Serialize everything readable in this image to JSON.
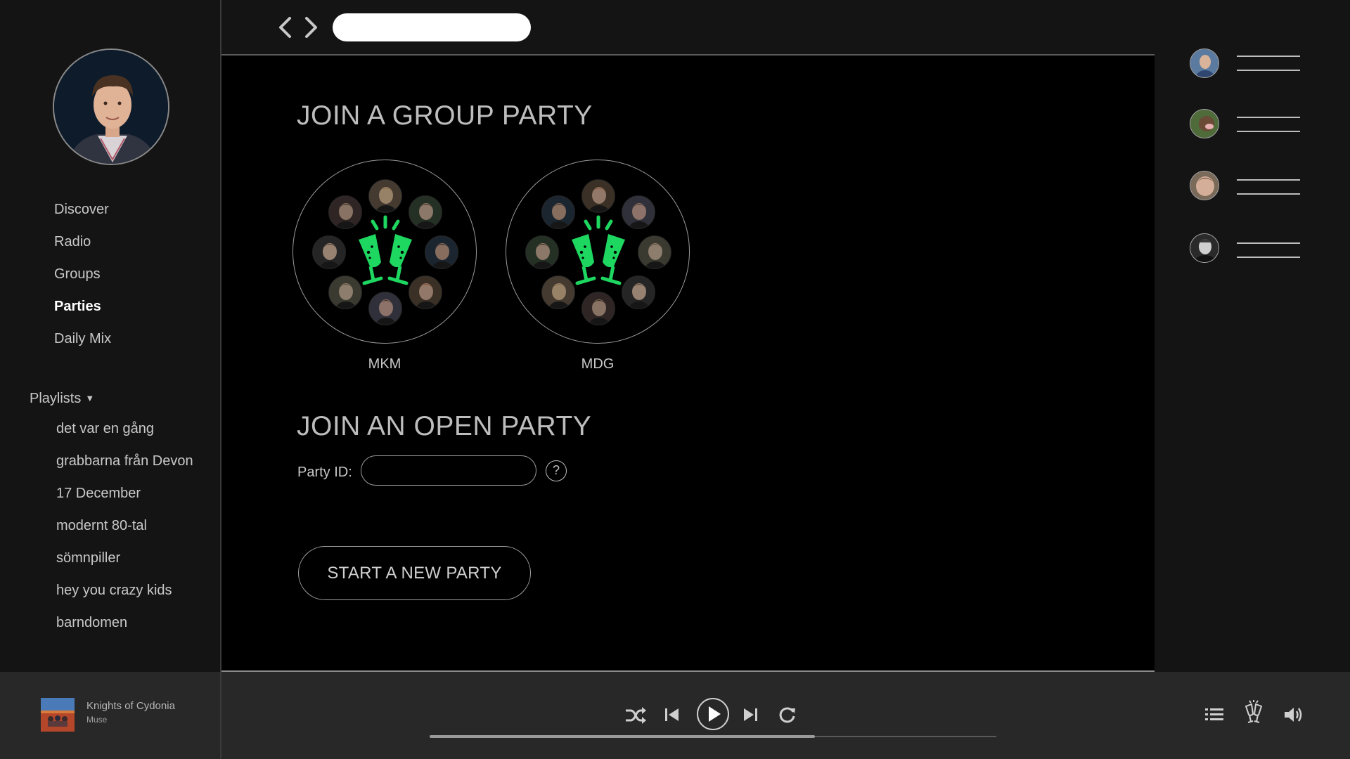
{
  "sidebar": {
    "nav": [
      {
        "label": "Discover",
        "active": false
      },
      {
        "label": "Radio",
        "active": false
      },
      {
        "label": "Groups",
        "active": false
      },
      {
        "label": "Parties",
        "active": true
      },
      {
        "label": "Daily Mix",
        "active": false
      }
    ],
    "playlists_label": "Playlists",
    "playlists_caret": "▼",
    "playlists": [
      "det var en gång",
      "grabbarna från Devon",
      "17 December",
      "modernt 80-tal",
      "sömnpiller",
      "hey you crazy kids",
      "barndomen"
    ]
  },
  "topbar": {
    "search_value": ""
  },
  "main": {
    "group_section_title": "JOIN A GROUP PARTY",
    "groups": [
      {
        "label": "MKM",
        "member_count": 8
      },
      {
        "label": "MDG",
        "member_count": 8
      }
    ],
    "open_section_title": "JOIN AN OPEN PARTY",
    "party_id_label": "Party ID:",
    "party_id_value": "",
    "help_label": "?",
    "start_button_label": "START A NEW PARTY"
  },
  "friends": {
    "count": 4
  },
  "player": {
    "track_title": "Knights of Cydonia",
    "track_artist": "Muse",
    "progress": 0.68,
    "controls": [
      "shuffle-icon",
      "previous-icon",
      "play-icon",
      "next-icon",
      "repeat-icon"
    ],
    "right_icons": [
      "queue-icon",
      "party-icon",
      "volume-icon"
    ]
  },
  "colors": {
    "accent": "#1ed760",
    "background": "#000000",
    "panel": "#141414",
    "player_bar": "#282828",
    "text": "#c8c8c8"
  }
}
